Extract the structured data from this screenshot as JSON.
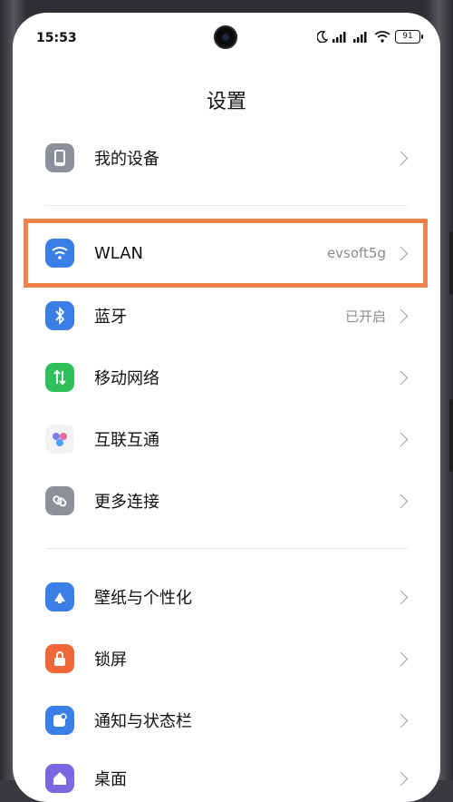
{
  "status_bar": {
    "time": "15:53",
    "battery": "91"
  },
  "page_title": "设置",
  "items": [
    {
      "label": "我的设备",
      "value": ""
    },
    {
      "label": "WLAN",
      "value": "evsoft5g"
    },
    {
      "label": "蓝牙",
      "value": "已开启"
    },
    {
      "label": "移动网络",
      "value": ""
    },
    {
      "label": "互联互通",
      "value": ""
    },
    {
      "label": "更多连接",
      "value": ""
    },
    {
      "label": "壁纸与个性化",
      "value": ""
    },
    {
      "label": "锁屏",
      "value": ""
    },
    {
      "label": "通知与状态栏",
      "value": ""
    },
    {
      "label": "桌面",
      "value": ""
    }
  ],
  "icons": [
    "device-icon",
    "wifi-icon",
    "bluetooth-icon",
    "mobile-network-icon",
    "interconnect-icon",
    "more-connections-icon",
    "wallpaper-icon",
    "lock-icon",
    "notification-icon",
    "home-icon"
  ],
  "colors": {
    "highlight": "#f0824a",
    "blue": "#3a7ee8",
    "green": "#2fbf5b",
    "orange": "#f0673a",
    "gray": "#8d8f9a"
  }
}
